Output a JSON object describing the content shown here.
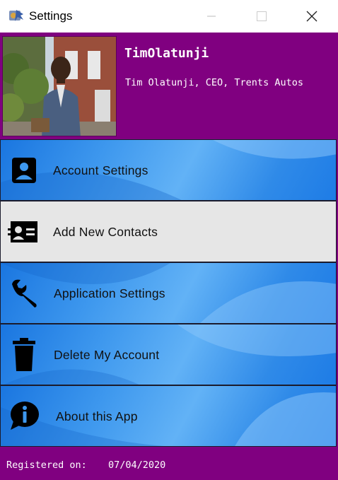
{
  "window": {
    "title": "Settings",
    "controls": [
      "minimize",
      "maximize",
      "close"
    ]
  },
  "profile": {
    "name": "TimOlatunji",
    "description": "Tim Olatunji, CEO, Trents Autos"
  },
  "menu": {
    "items": [
      {
        "label": "Account Settings",
        "icon": "user-card-icon",
        "selected": false
      },
      {
        "label": "Add New Contacts",
        "icon": "contact-card-icon",
        "selected": true
      },
      {
        "label": "Application Settings",
        "icon": "wrench-icon",
        "selected": false
      },
      {
        "label": "Delete My Account",
        "icon": "trash-icon",
        "selected": false
      },
      {
        "label": "About this App",
        "icon": "info-bubble-icon",
        "selected": false
      }
    ]
  },
  "footer": {
    "registered_label": "Registered on:",
    "registered_date": "07/04/2020"
  },
  "colors": {
    "header_bg": "#800080",
    "menu_blue": "#3e98ee",
    "menu_selected": "#e6e6e6"
  }
}
